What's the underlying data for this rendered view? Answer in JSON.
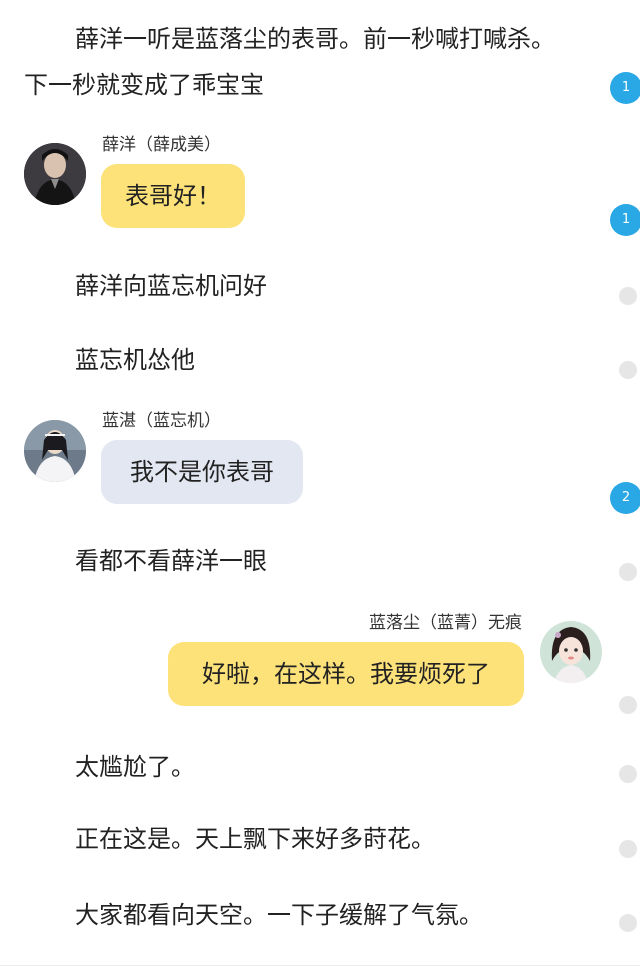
{
  "story": {
    "line1": "薛洋一听是蓝落尘的表哥。前一秒喊打喊杀。",
    "line2": "下一秒就变成了乖宝宝",
    "line3": "薛洋向蓝忘机问好",
    "line4": "蓝忘机怂他",
    "line5": "看都不看薛洋一眼",
    "line6": "太尴尬了。",
    "line7": "正在这是。天上飘下来好多莳花。",
    "line8": "大家都看向天空。一下子缓解了气氛。"
  },
  "chat": [
    {
      "sender": "薛洋（薛成美）",
      "text": "表哥好！",
      "side": "left",
      "bubble_color": "#fde27a"
    },
    {
      "sender": "蓝湛（蓝忘机）",
      "text": "我不是你表哥",
      "side": "left",
      "bubble_color": "#e3e7f2"
    },
    {
      "sender": "蓝落尘（蓝菁）无痕",
      "text": "好啦，在这样。我要烦死了",
      "side": "right",
      "bubble_color": "#fde27a"
    }
  ],
  "side_badges": [
    "1",
    "1",
    "2"
  ],
  "colors": {
    "badge": "#2aa8e6",
    "dot": "#e6e6e6",
    "yellow_bubble": "#fde27a",
    "grey_bubble": "#e3e7f2"
  },
  "icons": {
    "avatar1": "dark-robed-character-avatar",
    "avatar2": "white-robed-character-avatar",
    "avatar3": "girl-character-avatar"
  }
}
